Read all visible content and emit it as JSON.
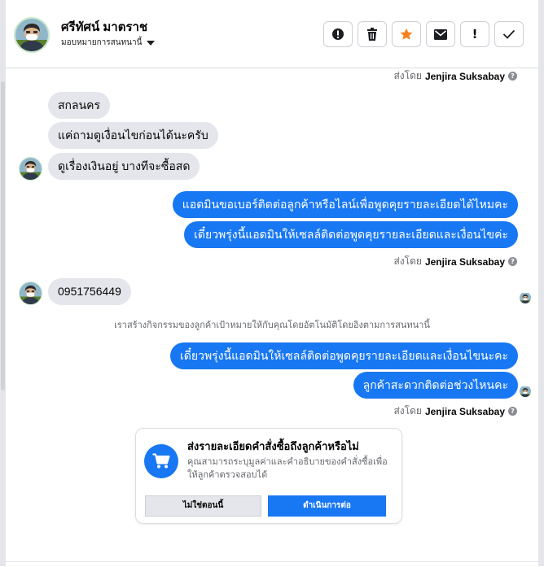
{
  "header": {
    "contact_name": "ศรีทัศน์ มาตราช",
    "assign_label": "มอบหมายการสนทนานี้",
    "actions": {
      "spam_icon": "exclamation-circle-icon",
      "delete_icon": "trash-icon",
      "star_icon": "star-icon",
      "mail_icon": "envelope-icon",
      "follow_up_label": "!",
      "done_icon": "check-icon"
    }
  },
  "sent_by": {
    "prefix": "ส่งโดย",
    "agent": "Jenjira Suksabay",
    "info_icon": "?"
  },
  "messages": {
    "incoming_1": "สกลนคร",
    "incoming_2": "แค่ถามดูเงื่อนไขก่อนได้นะครับ",
    "incoming_3": "ดูเรื่องเงินอยู่ บางทีจะซื้อสด",
    "outgoing_1": "แอดมินขอเบอร์ติดต่อลูกค้าหรือไลน์เพื่อพูดคุยรายละเอียดได้ไหมคะ",
    "outgoing_2": "เดี๋ยวพรุ่งนี้แอดมินให้เซลล์ติดต่อพูดคุยรายละเอียดและเงื่อนไขค่ะ",
    "incoming_4": "0951756449",
    "system_note": "เราสร้างกิจกรรมของลูกค้าเป้าหมายให้กับคุณโดยอัตโนมัติโดยอิงตามการสนทนานี้",
    "outgoing_3": "เดี๋ยวพรุ่งนี้แอดมินให้เซลล์ติดต่อพูดคุยรายละเอียดและเงื่อนไขนะคะ",
    "outgoing_4": "ลูกค้าสะดวกติดต่อช่วงไหนคะ"
  },
  "order_card": {
    "icon": "shopping-cart-icon",
    "title": "ส่งรายละเอียดคำสั่งซื้อถึงลูกค้าหรือไม่",
    "desc": "คุณสามารถระบุมูลค่าและคำอธิบายของคำสั่งซื้อเพื่อให้ลูกค้าตรวจสอบได้",
    "secondary_label": "ไม่ใช่ตอนนี้",
    "primary_label": "ดำเนินการต่อ"
  },
  "colors": {
    "accent": "#1877f2",
    "bubble_in": "#e4e6eb",
    "star": "#f5821f",
    "text_secondary": "#65676b"
  }
}
